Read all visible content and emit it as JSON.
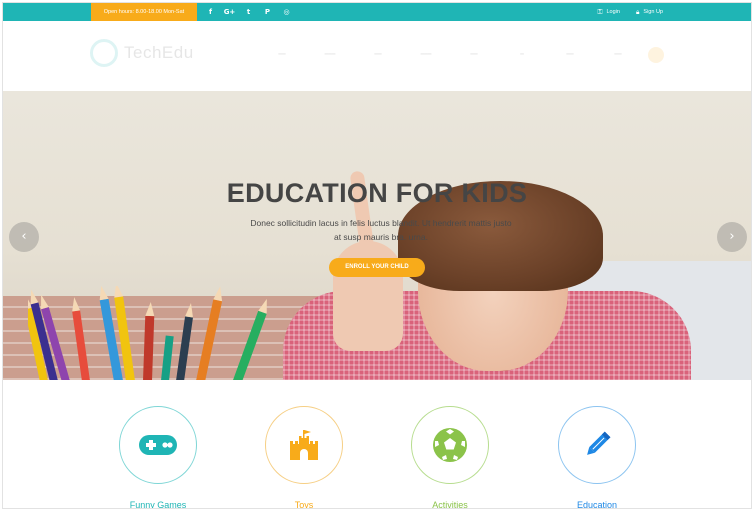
{
  "topbar": {
    "hours": "Open hours: 8.00-18.00 Mon-Sat",
    "social": [
      {
        "glyph": "f",
        "icon": "facebook-icon"
      },
      {
        "glyph": "G+",
        "icon": "google-plus-icon"
      },
      {
        "glyph": "t",
        "icon": "twitter-icon"
      },
      {
        "glyph": "P",
        "icon": "pinterest-icon"
      },
      {
        "glyph": "◎",
        "icon": "instagram-icon"
      }
    ],
    "login_label": "Login",
    "signup_label": "Sign Up",
    "bg_color": "#1fb5b5",
    "accent_color": "#f8ab1a"
  },
  "header": {
    "logo_text": "TechEdu"
  },
  "hero": {
    "title": "EDUCATION FOR KIDS",
    "subtitle_line1": "Donec sollicitudin lacus in felis luctus blandit. Ut hendrerit mattis justo",
    "subtitle_line2": "at susp mauris bra. urna.",
    "cta_label": "ENROLL YOUR CHILD",
    "prev_glyph": "‹",
    "next_glyph": "›"
  },
  "features": [
    {
      "label": "Funny Games",
      "color": "#1fb5b5",
      "icon": "gamepad-icon"
    },
    {
      "label": "Toys",
      "color": "#f8ab1a",
      "icon": "castle-icon"
    },
    {
      "label": "Activities",
      "color": "#8bc34a",
      "icon": "soccer-ball-icon"
    },
    {
      "label": "Education",
      "color": "#1e88e5",
      "icon": "pencil-icon"
    }
  ]
}
